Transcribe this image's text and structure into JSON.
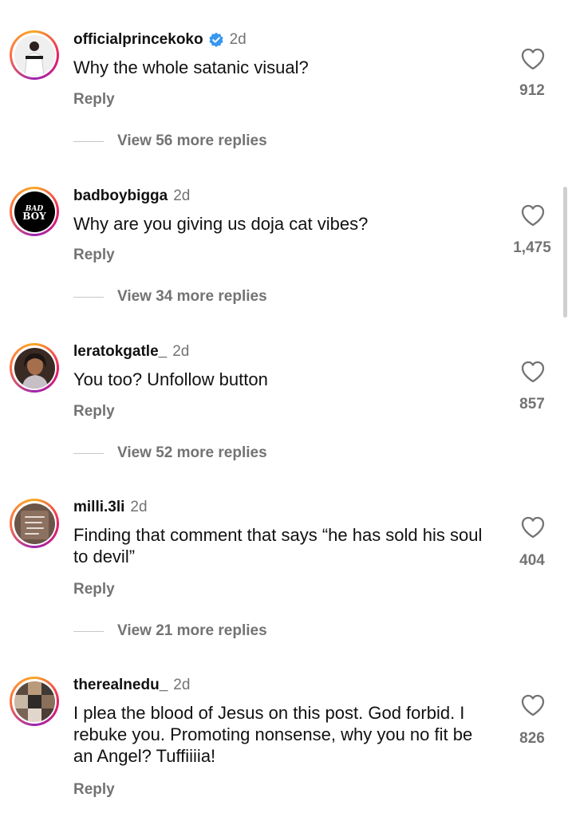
{
  "comments": [
    {
      "username": "officialprincekoko",
      "verified": true,
      "time": "2d",
      "text": "Why the whole satanic visual?",
      "reply_label": "Reply",
      "likes": "912",
      "view_more": "View 56 more replies"
    },
    {
      "username": "badboybigga",
      "verified": false,
      "time": "2d",
      "text": "Why are you giving us doja cat vibes?",
      "reply_label": "Reply",
      "likes": "1,475",
      "view_more": "View 34 more replies",
      "avatar_logo": "BAD BOY"
    },
    {
      "username": "leratokgatle_",
      "verified": false,
      "time": "2d",
      "text": "You too? Unfollow button",
      "reply_label": "Reply",
      "likes": "857",
      "view_more": "View 52 more replies"
    },
    {
      "username": "milli.3li",
      "verified": false,
      "time": "2d",
      "text": "Finding that comment that says “he has sold his soul to devil”",
      "reply_label": "Reply",
      "likes": "404",
      "view_more": "View 21 more replies"
    },
    {
      "username": "therealnedu_",
      "verified": false,
      "time": "2d",
      "text": "I plea the blood of Jesus on this post. God forbid. I rebuke you. Promoting nonsense, why you no fit be an Angel? Tuffiiiia!",
      "reply_label": "Reply",
      "likes": "826"
    }
  ],
  "icons": {
    "like": "heart-outline-icon",
    "verified": "verified-badge-icon"
  },
  "colors": {
    "verified_blue": "#3897f0",
    "secondary_text": "#737373",
    "story_ring": [
      "#f9a825",
      "#e91e63",
      "#9c27b0"
    ]
  }
}
